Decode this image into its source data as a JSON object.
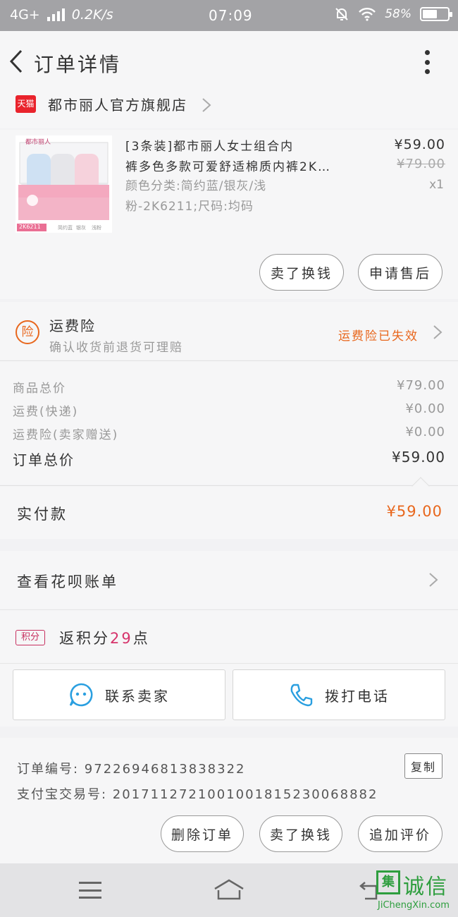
{
  "status_bar": {
    "network": "4G+",
    "speed": "0.2K/s",
    "time": "07:09",
    "battery": "58%",
    "battery_level": 0.58
  },
  "header": {
    "title": "订单详情",
    "back_icon": "back-arrow-icon",
    "more_icon": "more-vertical-icon"
  },
  "store": {
    "badge": "天猫",
    "name": "都市丽人官方旗舰店"
  },
  "product": {
    "title_line1": "[3条装]都市丽人女士组合内",
    "title_line2": "裤多色多款可爱舒适棉质内裤2K…",
    "spec_line1": "颜色分类:简约蓝/银灰/浅",
    "spec_line2": "粉-2K6211;尺码:均码",
    "price": "¥59.00",
    "original_price": "¥79.00",
    "quantity": "x1",
    "image": {
      "brand": "都市丽人",
      "code": "2K6211",
      "colors": [
        "简约蓝",
        "银灰",
        "浅粉"
      ]
    },
    "buttons": {
      "exchange": "卖了换钱",
      "after_sale": "申请售后"
    }
  },
  "insurance": {
    "icon": "险",
    "title": "运费险",
    "subtitle": "确认收货前退货可理赔",
    "status": "运费险已失效"
  },
  "summary": {
    "rows": [
      {
        "label": "商品总价",
        "value": "¥79.00"
      },
      {
        "label": "运费(快递)",
        "value": "¥0.00"
      },
      {
        "label": "运费险(卖家赠送)",
        "value": "¥0.00"
      }
    ],
    "total_label": "订单总价",
    "total_value": "¥59.00"
  },
  "paid": {
    "label": "实付款",
    "value": "¥59.00"
  },
  "bill": {
    "label": "查看花呗账单"
  },
  "points": {
    "badge": "积分",
    "prefix": "返积分",
    "count": "29",
    "suffix": "点"
  },
  "contact": {
    "seller": "联系卖家",
    "call": "拨打电话"
  },
  "order_info": {
    "order_no": "订单编号: 97226946813838322",
    "alipay_no": "支付宝交易号: 2017112721001001815230068882",
    "copy": "复制"
  },
  "bottom_buttons": {
    "delete": "删除订单",
    "exchange": "卖了换钱",
    "review": "追加评价"
  },
  "watermark": {
    "logo": "集",
    "text": "诚信",
    "url": "JiChengXin.com"
  },
  "colors": {
    "accent_orange": "#e8671d",
    "tmall_red": "#e9232c",
    "points_pink": "#d6336b",
    "contact_blue": "#2a9fe0",
    "watermark_green": "#2e9e3e"
  }
}
